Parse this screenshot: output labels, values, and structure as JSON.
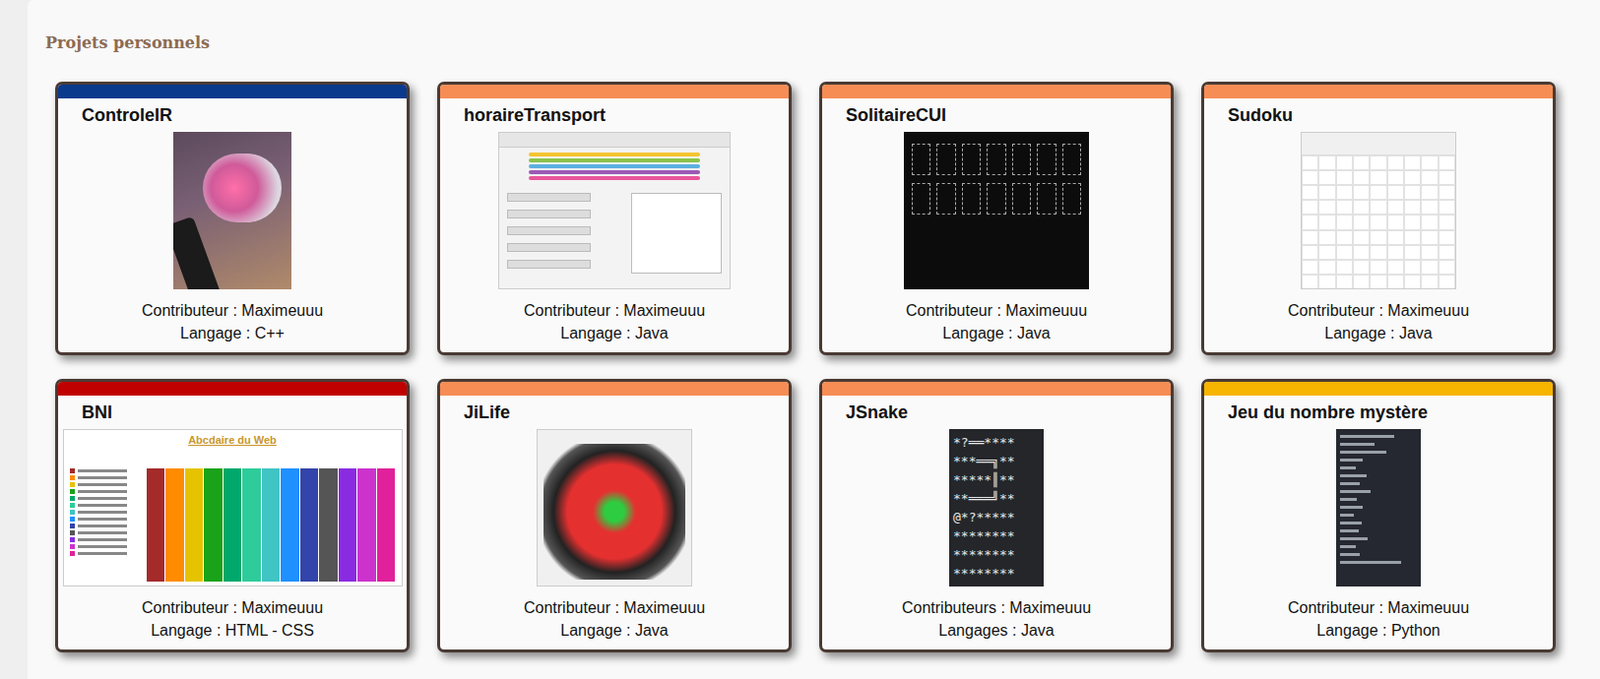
{
  "section": {
    "title": "Projets personnels"
  },
  "projects": [
    {
      "name": "ControleIR",
      "color": "#0a3a8c",
      "thumb": {
        "kind": "photo"
      },
      "contributor": "Contributeur : Maximeuuu",
      "language": "Langage : C++"
    },
    {
      "name": "horaireTransport",
      "color": "#f68d55",
      "thumb": {
        "kind": "app"
      },
      "contributor": "Contributeur : Maximeuuu",
      "language": "Langage : Java"
    },
    {
      "name": "SolitaireCUI",
      "color": "#f68d55",
      "thumb": {
        "kind": "cards"
      },
      "contributor": "Contributeur : Maximeuuu",
      "language": "Langage : Java"
    },
    {
      "name": "Sudoku",
      "color": "#f68d55",
      "thumb": {
        "kind": "sudoku"
      },
      "contributor": "Contributeur : Maximeuuu",
      "language": "Langage : Java"
    },
    {
      "name": "BNI",
      "color": "#c00000",
      "thumb": {
        "kind": "webpage",
        "heading": "Abcdaire du Web",
        "columns": [
          "#a52a2a",
          "#ff8c00",
          "#e6c300",
          "#1aa31a",
          "#00a86b",
          "#2ecc9a",
          "#40c4c4",
          "#1e90ff",
          "#3344aa",
          "#555555",
          "#8a2be2",
          "#cc33cc",
          "#e0219b"
        ]
      },
      "contributor": "Contributeur : Maximeuuu",
      "language": "Langage : HTML - CSS"
    },
    {
      "name": "JiLife",
      "color": "#f68d55",
      "thumb": {
        "kind": "life"
      },
      "contributor": "Contributeur : Maximeuuu",
      "language": "Langage : Java"
    },
    {
      "name": "JSnake",
      "color": "#f68d55",
      "thumb": {
        "kind": "ascii",
        "lines": [
          "*?══****",
          "***══╗**",
          "*****║**",
          "**═══╝**",
          "@*?*****",
          "********",
          "********",
          "********"
        ]
      },
      "contributor": "Contributeurs : Maximeuuu",
      "language": "Langages : Java"
    },
    {
      "name": "Jeu du nombre mystère",
      "color": "#f7b500",
      "thumb": {
        "kind": "console"
      },
      "contributor": "Contributeur : Maximeuuu",
      "language": "Langage : Python"
    }
  ]
}
